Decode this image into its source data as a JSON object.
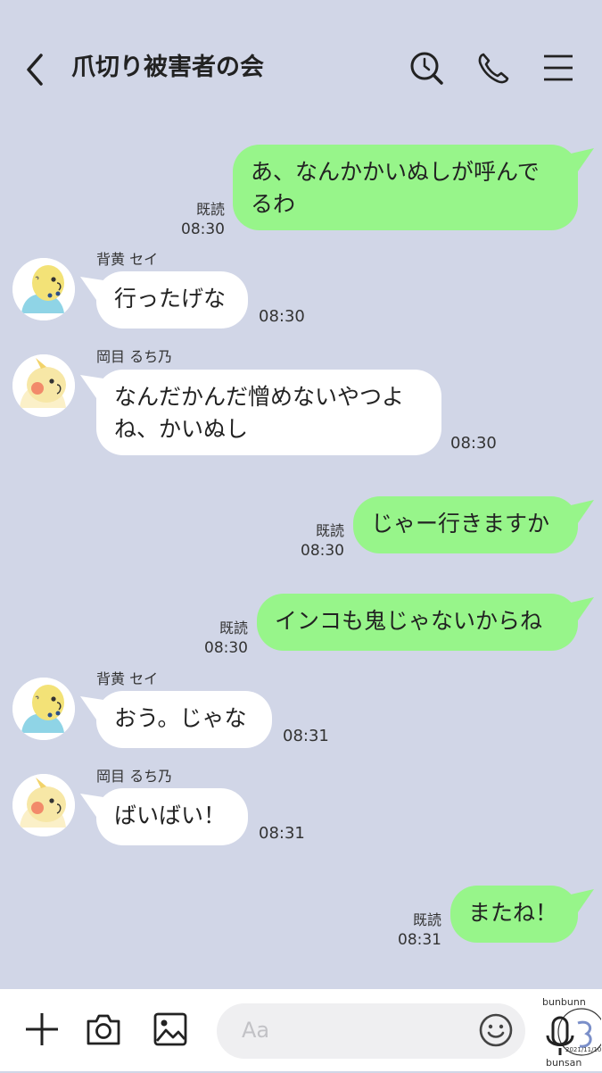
{
  "header": {
    "title": "爪切り被害者の会",
    "icons": [
      "back-chevron-icon",
      "search-icon",
      "phone-icon",
      "menu-icon"
    ]
  },
  "messages": [
    {
      "side": "out",
      "text_lines": [
        "あ、なんかかいぬしが呼んで",
        "るわ"
      ],
      "read": "既読",
      "time": "08:30"
    },
    {
      "side": "in",
      "sender": "背黄 セイ",
      "avatar": "budgie-avatar",
      "text_lines": [
        "行ったげな"
      ],
      "time": "08:30"
    },
    {
      "side": "in",
      "sender": "岡目 るち乃",
      "avatar": "cockatiel-avatar",
      "text_lines": [
        "なんだかんだ憎めないやつよ",
        "ね、かいぬし"
      ],
      "time": "08:30"
    },
    {
      "side": "out",
      "text_lines": [
        "じゃー行きますか"
      ],
      "read": "既読",
      "time": "08:30"
    },
    {
      "side": "out",
      "text_lines": [
        "インコも鬼じゃないからね"
      ],
      "read": "既読",
      "time": "08:30"
    },
    {
      "side": "in",
      "sender": "背黄 セイ",
      "avatar": "budgie-avatar",
      "text_lines": [
        "おう。じゃな"
      ],
      "time": "08:31"
    },
    {
      "side": "in",
      "sender": "岡目 るち乃",
      "avatar": "cockatiel-avatar",
      "text_lines": [
        "ばいばい！"
      ],
      "time": "08:31"
    },
    {
      "side": "out",
      "text_lines": [
        "またね！"
      ],
      "read": "既読",
      "time": "08:31"
    }
  ],
  "input_bar": {
    "placeholder": "Aa",
    "icons": [
      "plus-icon",
      "camera-icon",
      "image-icon",
      "emoji-icon",
      "microphone-icon"
    ]
  },
  "watermark": {
    "text_top": "bunbunn",
    "text_bottom": "bunsan",
    "date": "2021/11/10"
  },
  "colors": {
    "background": "#d1d6e7",
    "outgoing_bubble": "#97f58a",
    "incoming_bubble": "#ffffff"
  }
}
